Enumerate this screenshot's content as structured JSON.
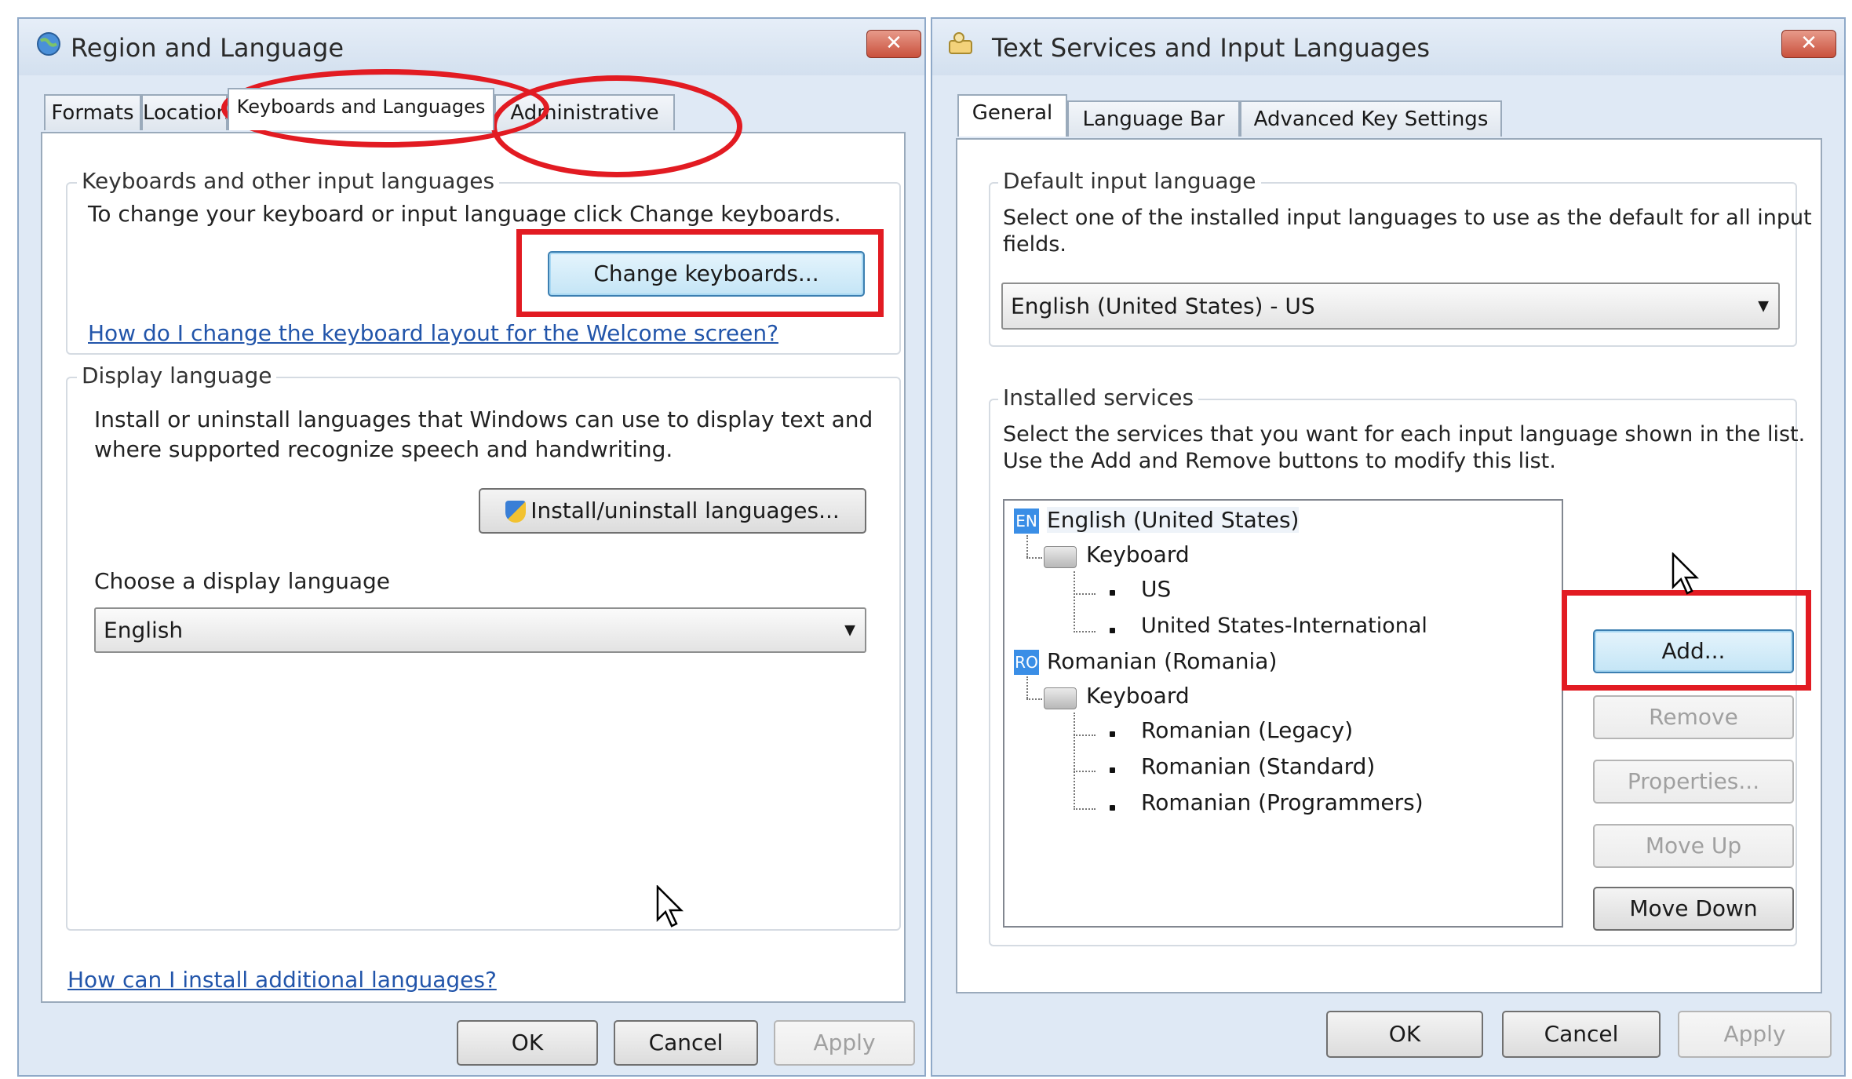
{
  "left_window": {
    "title": "Region and Language",
    "close_label": "✕",
    "tabs": [
      "Formats",
      "Location",
      "Keyboards and Languages",
      "Administrative"
    ],
    "keyboards_group": {
      "title": "Keyboards and other input languages",
      "description": "To change your keyboard or input language click Change keyboards.",
      "change_button": "Change keyboards...",
      "link": "How do I change the keyboard layout for the Welcome screen?"
    },
    "display_group": {
      "title": "Display language",
      "description_line1": "Install or uninstall languages that Windows can use to display text and",
      "description_line2": "where supported recognize speech and handwriting.",
      "install_button": "Install/uninstall languages...",
      "choose_label": "Choose a display language",
      "selected_language": "English"
    },
    "bottom_link": "How can I install additional languages?",
    "ok": "OK",
    "cancel": "Cancel",
    "apply": "Apply"
  },
  "right_window": {
    "title": "Text Services and Input Languages",
    "close_label": "✕",
    "tabs": [
      "General",
      "Language Bar",
      "Advanced Key Settings"
    ],
    "default_group": {
      "title": "Default input language",
      "description_line1": "Select one of the installed input languages to use as the default for all input",
      "description_line2": "fields.",
      "selected": "English (United States) - US"
    },
    "installed_group": {
      "title": "Installed services",
      "description_line1": "Select the services that you want for each input language shown in the list.",
      "description_line2": "Use the Add and Remove buttons to modify this list."
    },
    "tree": {
      "lang1_badge": "EN",
      "lang1": "English (United States)",
      "lang1_keyboard": "Keyboard",
      "lang1_items": [
        "US",
        "United States-International"
      ],
      "lang2_badge": "RO",
      "lang2": "Romanian (Romania)",
      "lang2_keyboard": "Keyboard",
      "lang2_items": [
        "Romanian (Legacy)",
        "Romanian (Standard)",
        "Romanian (Programmers)"
      ]
    },
    "buttons": {
      "add": "Add...",
      "remove": "Remove",
      "properties": "Properties...",
      "move_up": "Move Up",
      "move_down": "Move Down"
    },
    "ok": "OK",
    "cancel": "Cancel",
    "apply": "Apply"
  },
  "colors": {
    "annotation_red": "#e21b22",
    "link_blue": "#2255aa",
    "language_badge": "#3a8ee6"
  }
}
